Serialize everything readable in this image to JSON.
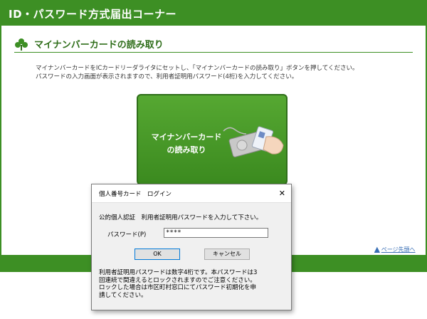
{
  "header": {
    "title": "ID・パスワード方式届出コーナー"
  },
  "section": {
    "title": "マイナンバーカードの読み取り",
    "icon": "clover-icon",
    "instructions": [
      "マイナンバーカードをICカードリーダライタにセットし、「マイナンバーカードの読み取り」ボタンを押してください。",
      "パスワードの入力画面が表示されますので、利用者証明用パスワード(4桁)を入力してください。"
    ]
  },
  "reader_button": {
    "label_line1": "マイナンバーカード",
    "label_line2": "の読み取り",
    "icon": "card-reader-icon"
  },
  "page_top_link": {
    "label": "ページ先頭へ",
    "icon": "up-arrow-icon"
  },
  "dialog": {
    "title": "個人番号カード　ログイン",
    "close_icon": "close-icon",
    "message": "公的個人認証　利用者証明用パスワードを入力して下さい。",
    "password_label": "パスワード(P)",
    "password_value": "****",
    "ok_label": "OK",
    "cancel_label": "キャンセル",
    "note_lines": [
      "利用者証明用パスワードは数字4桁です。本パスワードは3",
      "回連続で間違えるとロックされますのでご注意ください。",
      "ロックした場合は市区町村窓口にてパスワード初期化を申",
      "請してください。"
    ]
  },
  "colors": {
    "brand_green": "#3d8f24",
    "dark_green": "#2f6e1a",
    "link_blue": "#3a6fb5"
  }
}
